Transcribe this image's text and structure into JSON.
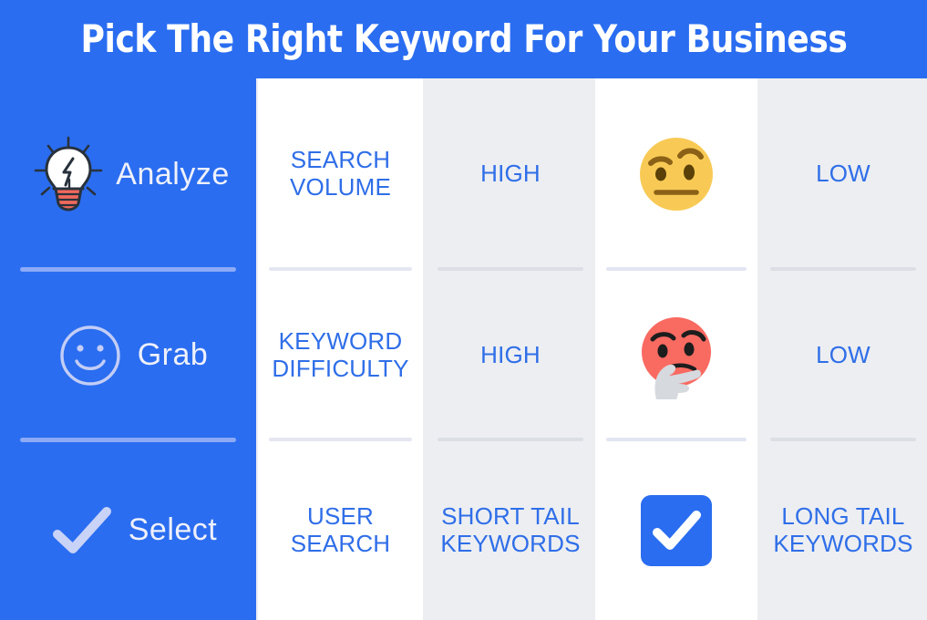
{
  "header": {
    "title": "Pick The Right Keyword For Your Business"
  },
  "colors": {
    "brand_blue": "#2a6df0",
    "text_blue": "#2f6ee8",
    "panel_white": "#ffffff",
    "panel_gray": "#eceef2",
    "divider_blue": "#8caaf6",
    "divider_gray": "#dcdfe6",
    "emoji_yellow": "#f7ca55",
    "emoji_red": "#f96a61",
    "bulb_red": "#f2695c"
  },
  "sidebar": {
    "steps": [
      {
        "label": "Analyze",
        "icon": "lightbulb-icon"
      },
      {
        "label": "Grab",
        "icon": "smiley-face-icon"
      },
      {
        "label": "Select",
        "icon": "checkmark-icon"
      }
    ]
  },
  "columns": [
    {
      "id": "metric",
      "background": "white",
      "cells": [
        {
          "text": "SEARCH\nVOLUME"
        },
        {
          "text": "KEYWORD\nDIFFICULTY"
        },
        {
          "text": "USER\nSEARCH"
        }
      ]
    },
    {
      "id": "level",
      "background": "gray",
      "cells": [
        {
          "text": "HIGH"
        },
        {
          "text": "HIGH"
        },
        {
          "text": "SHORT TAIL\nKEYWORDS"
        }
      ]
    },
    {
      "id": "reaction",
      "background": "white",
      "cells": [
        {
          "icon": "raised-eyebrow-emoji"
        },
        {
          "icon": "thinking-face-emoji"
        },
        {
          "icon": "blue-checkbox-icon"
        }
      ]
    },
    {
      "id": "alternative",
      "background": "gray",
      "cells": [
        {
          "text": "LOW"
        },
        {
          "text": "LOW"
        },
        {
          "text": "LONG TAIL\nKEYWORDS"
        }
      ]
    }
  ]
}
